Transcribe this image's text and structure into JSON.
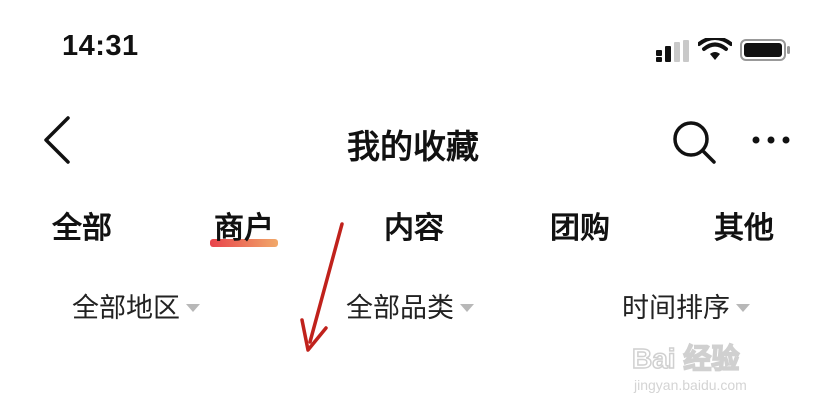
{
  "status_bar": {
    "time": "14:31"
  },
  "nav": {
    "title": "我的收藏"
  },
  "tabs": [
    {
      "label": "全部"
    },
    {
      "label": "商户",
      "active": true
    },
    {
      "label": "内容"
    },
    {
      "label": "团购"
    },
    {
      "label": "其他"
    }
  ],
  "filters": [
    {
      "label": "全部地区"
    },
    {
      "label": "全部品类"
    },
    {
      "label": "时间排序"
    }
  ],
  "watermark": {
    "brand": "Bai 经验",
    "url": "jingyan.baidu.com"
  },
  "colors": {
    "text": "#111111",
    "active_tab_gradient_start": "#e8434b",
    "active_tab_gradient_end": "#f1a96a",
    "caret": "#b8b8b8",
    "annotation_arrow": "#c0221c"
  },
  "icons": {
    "back": "chevron-left-icon",
    "search": "search-icon",
    "more": "more-dots-icon",
    "signal": "signal-icon",
    "wifi": "wifi-icon",
    "battery": "battery-icon"
  }
}
